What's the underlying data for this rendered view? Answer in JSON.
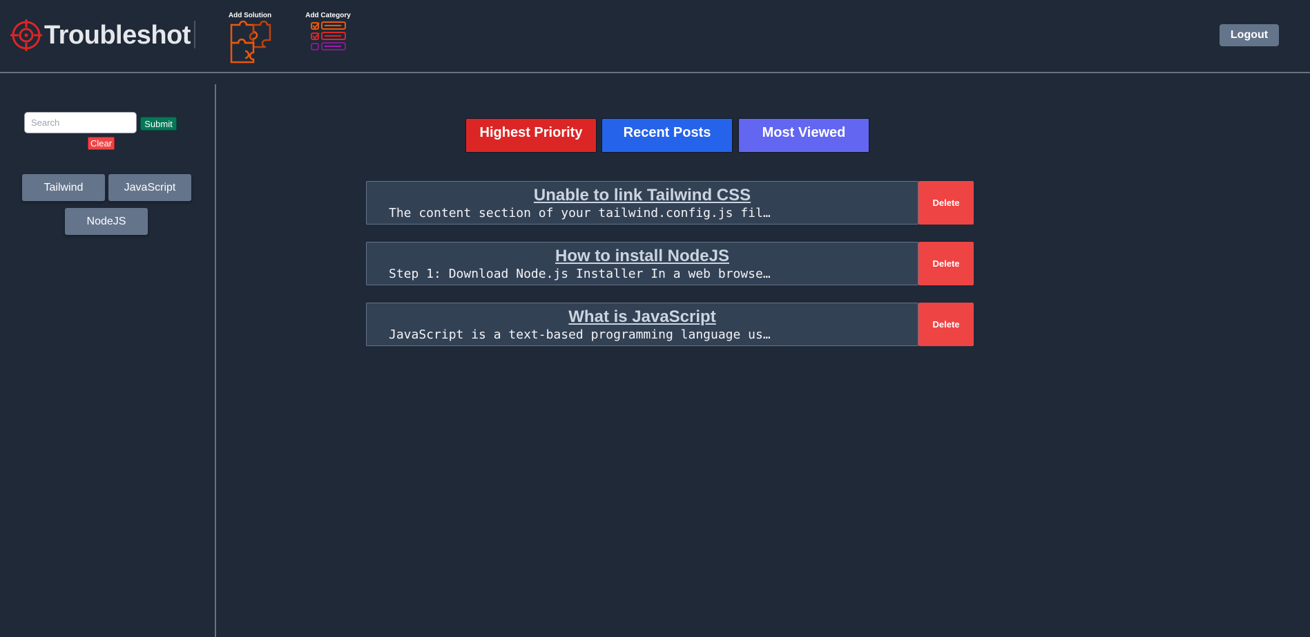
{
  "header": {
    "brand": "Troubleshot",
    "add_solution_label": "Add Solution",
    "add_category_label": "Add Category",
    "logout_label": "Logout",
    "accent_color": "#dc2626"
  },
  "sidebar": {
    "search_placeholder": "Search",
    "search_value": "",
    "submit_label": "Submit",
    "clear_label": "Clear",
    "categories": [
      {
        "label": "Tailwind"
      },
      {
        "label": "JavaScript"
      },
      {
        "label": "NodeJS"
      }
    ]
  },
  "filters": {
    "priority_label": "Highest Priority",
    "recent_label": "Recent Posts",
    "viewed_label": "Most Viewed",
    "priority_color": "#dc2626",
    "recent_color": "#2563eb",
    "viewed_color": "#6366f1"
  },
  "posts": [
    {
      "title": "Unable to link Tailwind CSS",
      "excerpt": "The content section of your tailwind.config.js fil…",
      "delete_label": "Delete"
    },
    {
      "title": "How to install NodeJS",
      "excerpt": "Step 1: Download Node.js Installer In a web browse…",
      "delete_label": "Delete"
    },
    {
      "title": "What is JavaScript",
      "excerpt": "JavaScript is a text-based programming language us…",
      "delete_label": "Delete"
    }
  ]
}
